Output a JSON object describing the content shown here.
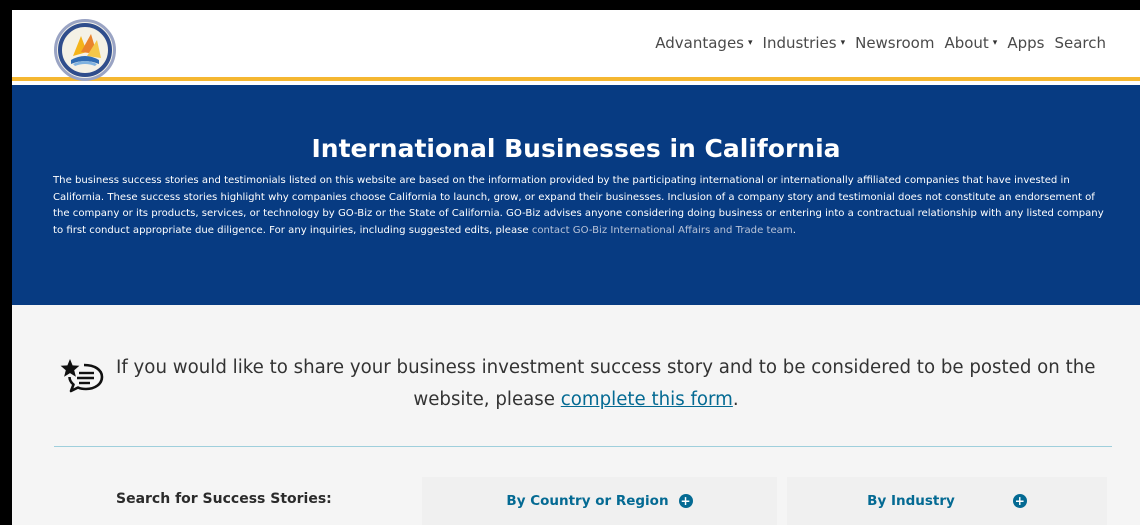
{
  "nav": {
    "items": [
      {
        "label": "Advantages",
        "caret": "▾"
      },
      {
        "label": "Industries",
        "caret": "▾"
      },
      {
        "label": "Newsroom",
        "caret": ""
      },
      {
        "label": "About",
        "caret": "▾"
      },
      {
        "label": "Apps",
        "caret": ""
      },
      {
        "label": "Search",
        "caret": ""
      }
    ]
  },
  "hero": {
    "title": "International Businesses in California",
    "text": "The business success stories and testimonials listed on this website are based on the information provided by the participating international or internationally affiliated companies that have invested in California. These success stories highlight why companies choose California to launch, grow, or expand their businesses. Inclusion of a company story and testimonial does not constitute an endorsement of the company or its products, services, or technology by GO-Biz or the State of California. GO-Biz advises anyone considering doing business or entering into a contractual relationship with any listed company to first conduct appropriate due diligence. For any inquiries, including suggested edits, please ",
    "link": "contact GO-Biz International Affairs and Trade team",
    "link_suffix": "."
  },
  "share": {
    "line1": "If you would like to share your business investment success story and to be considered to be posted on the",
    "line2_prefix": "website, please ",
    "line2_link": "complete this form",
    "line2_suffix": "."
  },
  "search": {
    "label": "Search for Success Stories:",
    "by_country": "By Country or Region",
    "by_industry": "By Industry",
    "plus_glyph": "+"
  },
  "colors": {
    "hero_bg": "#073b82",
    "accent_gold": "#f5b731",
    "link_teal": "#046a93"
  }
}
